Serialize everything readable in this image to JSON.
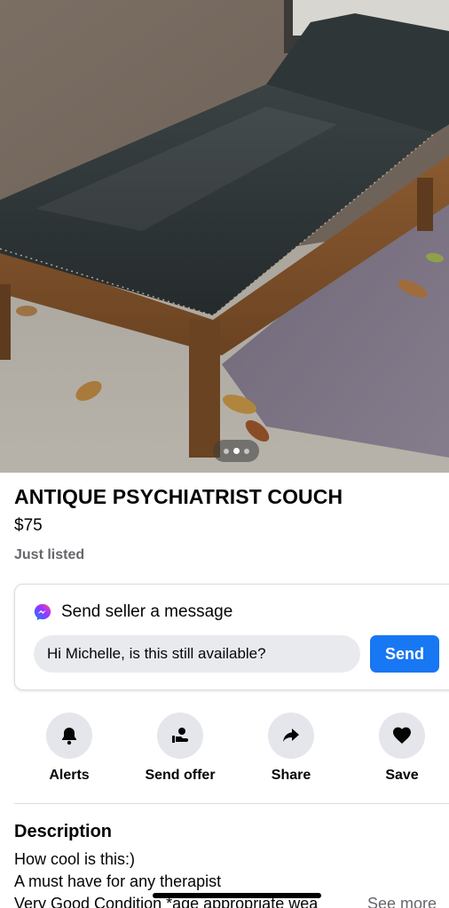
{
  "listing": {
    "title": "ANTIQUE PSYCHIATRIST COUCH",
    "price": "$75",
    "status": "Just listed"
  },
  "photo": {
    "subject": "antique leather couch",
    "pager_dots": 3,
    "active_dot": 2
  },
  "message": {
    "heading": "Send seller a message",
    "input_value": "Hi Michelle, is this still available?",
    "send_label": "Send",
    "icon": "messenger-icon"
  },
  "actions": [
    {
      "label": "Alerts",
      "icon": "bell-icon"
    },
    {
      "label": "Send offer",
      "icon": "offer-icon"
    },
    {
      "label": "Share",
      "icon": "share-icon"
    },
    {
      "label": "Save",
      "icon": "heart-icon"
    }
  ],
  "description": {
    "heading": "Description",
    "lines": [
      "How cool is this:)",
      "A must have for any therapist",
      "Very Good Condition *age appropriate wea"
    ],
    "see_more": "See more"
  },
  "colors": {
    "accent": "#1877f2",
    "secondary_text": "#65676b",
    "button_bg": "#e4e6eb"
  }
}
